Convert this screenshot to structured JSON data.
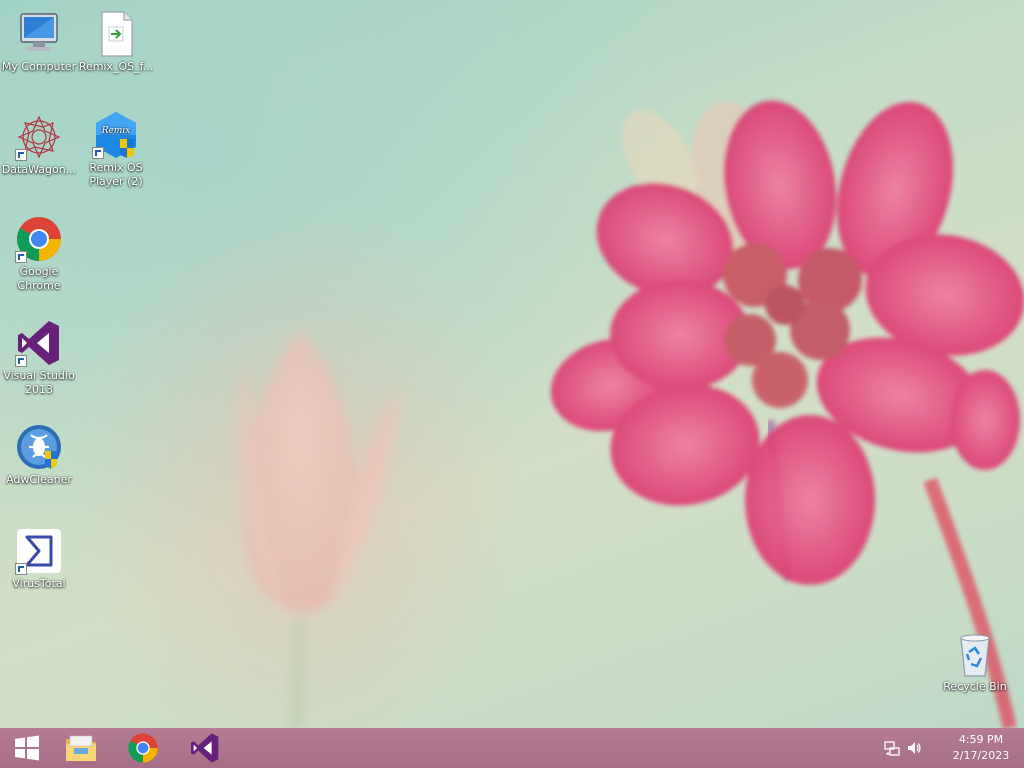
{
  "desktop_icons": [
    {
      "label": "My Computer",
      "icon": "my-computer-icon"
    },
    {
      "label": "Remix_OS_f...",
      "icon": "remix-file-icon"
    },
    {
      "label": "DataWagon...",
      "icon": "datawagon-icon"
    },
    {
      "label": "Remix OS Player (2)",
      "icon": "remix-os-player-icon"
    },
    {
      "label": "Google Chrome",
      "icon": "chrome-icon"
    },
    {
      "label": "Visual Studio 2013",
      "icon": "visual-studio-icon"
    },
    {
      "label": "AdwCleaner",
      "icon": "adwcleaner-icon"
    },
    {
      "label": "VirusTotal",
      "icon": "virustotal-icon"
    },
    {
      "label": "Recycle Bin",
      "icon": "recycle-bin-icon"
    }
  ],
  "taskbar": {
    "pinned": [
      {
        "name": "start",
        "icon": "windows-start-icon"
      },
      {
        "name": "file-explorer",
        "icon": "file-explorer-icon"
      },
      {
        "name": "chrome",
        "icon": "chrome-icon"
      },
      {
        "name": "visual-studio",
        "icon": "visual-studio-icon"
      }
    ],
    "tray": {
      "icons": [
        "network-icon",
        "volume-icon"
      ],
      "time": "4:59 PM",
      "date": "2/17/2023"
    }
  },
  "colors": {
    "taskbar": "#a66f88",
    "visual_studio": "#68217a",
    "flower": "#e0457a"
  }
}
